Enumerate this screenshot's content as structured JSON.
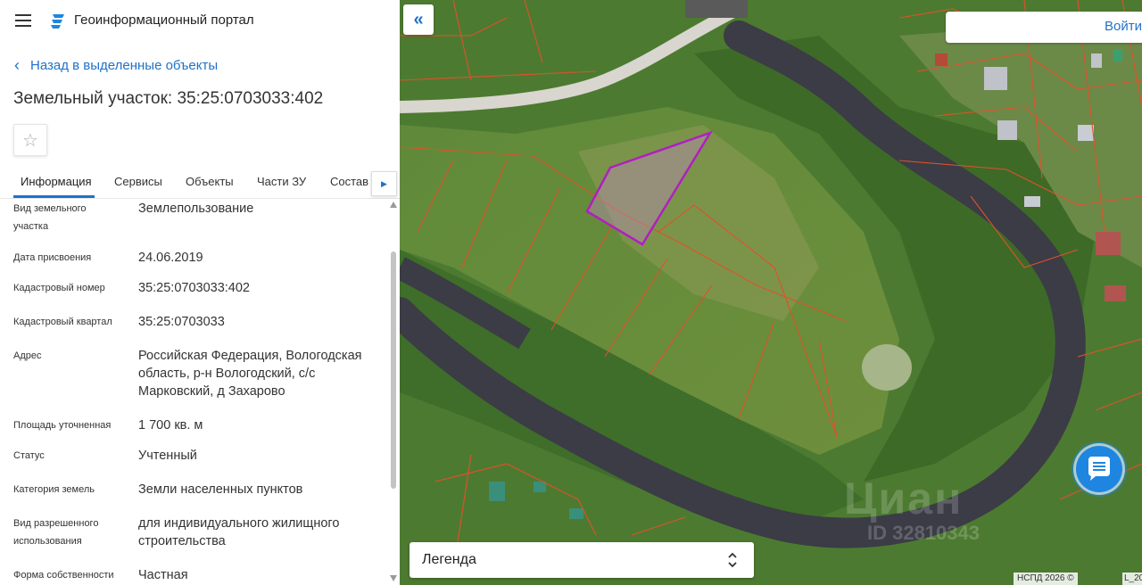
{
  "header": {
    "app_title": "Геоинформационный портал"
  },
  "nav": {
    "back_label": "Назад в выделенные объекты"
  },
  "object": {
    "title": "Земельный участок: 35:25:0703033:402"
  },
  "tabs": [
    {
      "label": "Информация",
      "active": true
    },
    {
      "label": "Сервисы"
    },
    {
      "label": "Объекты"
    },
    {
      "label": "Части ЗУ"
    },
    {
      "label": "Состав"
    }
  ],
  "info_rows": [
    {
      "label": "Вид земельного участка",
      "value": "Землепользование"
    },
    {
      "label": "Дата присвоения",
      "value": "24.06.2019"
    },
    {
      "label": "Кадастровый номер",
      "value": "35:25:0703033:402"
    },
    {
      "label": "Кадастровый квартал",
      "value": "35:25:0703033"
    },
    {
      "label": "Адрес",
      "value": "Российская Федерация, Вологодская область, р-н Вологодский, с/с Марковский, д Захарово"
    },
    {
      "label": "Площадь уточненная",
      "value": "1 700 кв. м"
    },
    {
      "label": "Статус",
      "value": "Учтенный"
    },
    {
      "label": "Категория земель",
      "value": "Земли населенных пунктов"
    },
    {
      "label": "Вид разрешенного использования",
      "value": "для индивидуального жилищного строительства"
    },
    {
      "label": "Форма собственности",
      "value": "Частная"
    }
  ],
  "map": {
    "login_label": "Войти",
    "legend_label": "Легенда",
    "attribution": "НСПД 2026 ©",
    "attribution_extra": "L_20",
    "watermark": " Циан",
    "watermark_id": "ID 32810343"
  },
  "colors": {
    "accent": "#1f72c8",
    "parcel_highlight": "#b01fc0",
    "cadastral_lines": "#e0512a",
    "chat_button": "#1e86e0"
  },
  "icons": {
    "menu": "hamburger-icon",
    "logo": "portal-logo-icon",
    "back": "chevron-left-icon",
    "favorite": "star-icon",
    "tab_next": "triangle-right-icon",
    "collapse": "double-chevron-left-icon",
    "legend_toggle": "chevron-up-down-icon",
    "chat": "chat-icon"
  }
}
